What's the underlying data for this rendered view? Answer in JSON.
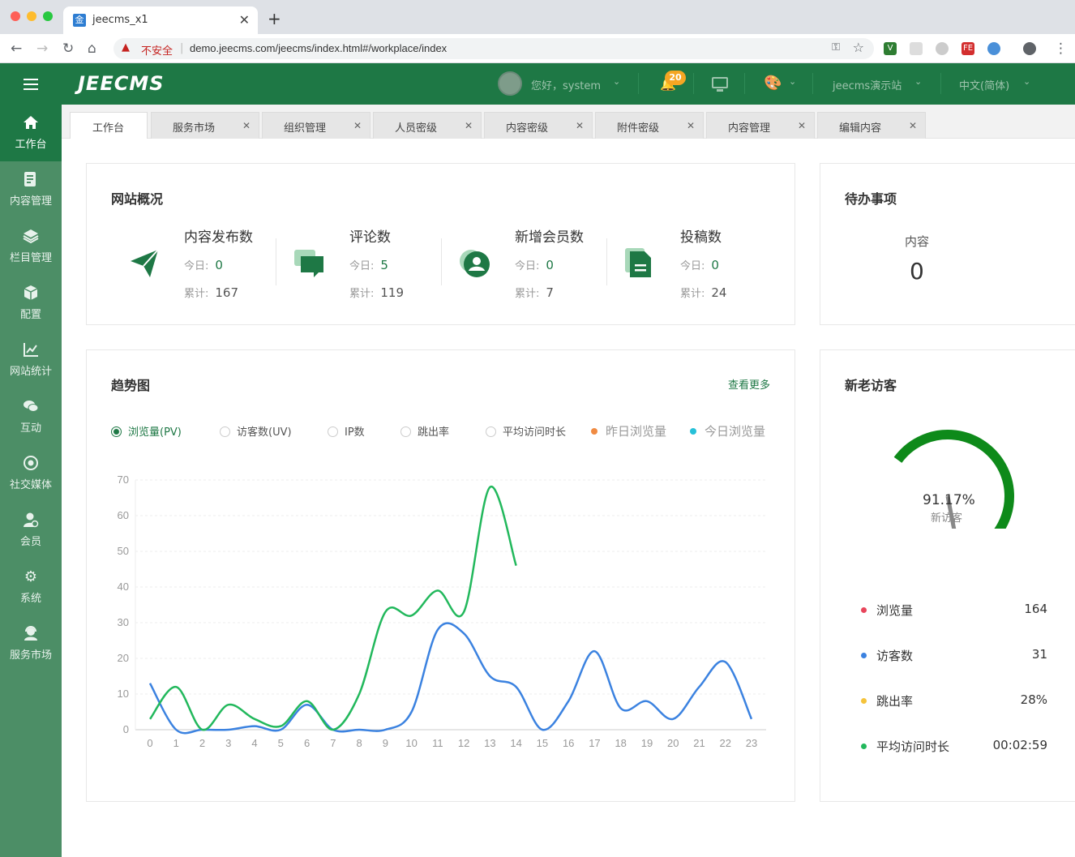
{
  "browser": {
    "tab_title": "jeecms_x1",
    "favicon_text": "金",
    "insecure_label": "不安全",
    "url": "demo.jeecms.com/jeecms/index.html#/workplace/index"
  },
  "header": {
    "logo": "JEECMS",
    "greeting": "您好，system",
    "notification_count": "20",
    "site_name": "jeecms演示站",
    "language": "中文(简体)",
    "theme_color": "#1e7845"
  },
  "sidebar": {
    "items": [
      {
        "label": "工作台",
        "icon": "home-icon"
      },
      {
        "label": "内容管理",
        "icon": "document-edit-icon"
      },
      {
        "label": "栏目管理",
        "icon": "layers-icon"
      },
      {
        "label": "配置",
        "icon": "cube-icon"
      },
      {
        "label": "网站统计",
        "icon": "line-chart-icon"
      },
      {
        "label": "互动",
        "icon": "chat-icon"
      },
      {
        "label": "社交媒体",
        "icon": "target-icon"
      },
      {
        "label": "会员",
        "icon": "member-icon"
      },
      {
        "label": "系统",
        "icon": "gear-icon"
      },
      {
        "label": "服务市场",
        "icon": "service-icon"
      }
    ]
  },
  "tabs": [
    {
      "label": "工作台"
    },
    {
      "label": "服务市场"
    },
    {
      "label": "组织管理"
    },
    {
      "label": "人员密级"
    },
    {
      "label": "内容密级"
    },
    {
      "label": "附件密级"
    },
    {
      "label": "内容管理"
    },
    {
      "label": "编辑内容"
    }
  ],
  "overview": {
    "title": "网站概况",
    "today_label": "今日:",
    "total_label": "累计:",
    "stats": [
      {
        "name": "内容发布数",
        "today": "0",
        "total": "167",
        "icon": "paper-plane-icon"
      },
      {
        "name": "评论数",
        "today": "5",
        "total": "119",
        "icon": "comments-icon"
      },
      {
        "name": "新增会员数",
        "today": "0",
        "total": "7",
        "icon": "user-circle-icon"
      },
      {
        "name": "投稿数",
        "today": "0",
        "total": "24",
        "icon": "file-text-icon"
      }
    ]
  },
  "todo": {
    "title": "待办事项",
    "label": "内容",
    "value": "0"
  },
  "trend": {
    "title": "趋势图",
    "more": "查看更多",
    "metrics": [
      {
        "label": "浏览量(PV)",
        "selected": true
      },
      {
        "label": "访客数(UV)",
        "selected": false
      },
      {
        "label": "IP数",
        "selected": false
      },
      {
        "label": "跳出率",
        "selected": false
      },
      {
        "label": "平均访问时长",
        "selected": false
      }
    ],
    "legend": [
      {
        "label": "昨日浏览量",
        "color": "#f08b42"
      },
      {
        "label": "今日浏览量",
        "color": "#26c0d8"
      }
    ]
  },
  "chart_data": {
    "type": "line",
    "x": [
      0,
      1,
      2,
      3,
      4,
      5,
      6,
      7,
      8,
      9,
      10,
      11,
      12,
      13,
      14,
      15,
      16,
      17,
      18,
      19,
      20,
      21,
      22,
      23
    ],
    "ylim": [
      0,
      70
    ],
    "yticks": [
      0,
      10,
      20,
      30,
      40,
      50,
      60,
      70
    ],
    "grid": true,
    "series": [
      {
        "name": "今日浏览量",
        "color": "#22b85c",
        "values": [
          3,
          12,
          0,
          7,
          3,
          1,
          8,
          0,
          10,
          33,
          32,
          39,
          33,
          68,
          46
        ]
      },
      {
        "name": "昨日浏览量",
        "color": "#3b82e0",
        "values": [
          13,
          0,
          0,
          0,
          1,
          0,
          7,
          0,
          0,
          0,
          5,
          28,
          27,
          15,
          12,
          0,
          8,
          22,
          6,
          8,
          3,
          12,
          19,
          3
        ]
      }
    ]
  },
  "visitors": {
    "title": "新老访客",
    "gauge_percent": "91.17%",
    "gauge_label": "新访客",
    "gauge_fraction": 0.9117,
    "rows": [
      {
        "label": "浏览量",
        "value": "164",
        "color": "#e8455b"
      },
      {
        "label": "访客数",
        "value": "31",
        "color": "#3b82e0"
      },
      {
        "label": "跳出率",
        "value": "28%",
        "color": "#f5c33b"
      },
      {
        "label": "平均访问时长",
        "value": "00:02:59",
        "color": "#22b85c"
      }
    ]
  }
}
